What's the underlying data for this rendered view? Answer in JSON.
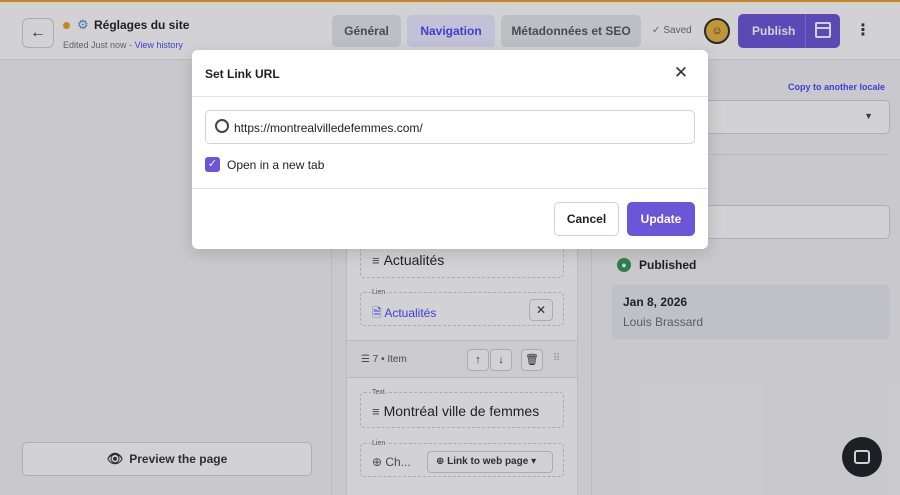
{
  "header": {
    "title": "Réglages du site",
    "edited_prefix": "Edited Just now -",
    "view_history": "View history",
    "tabs": [
      {
        "label": "Général"
      },
      {
        "label": "Navigation"
      },
      {
        "label": "Métadonnées et SEO"
      }
    ],
    "saved_label": "Saved",
    "publish_label": "Publish",
    "accent_color": "#6b55d8"
  },
  "left_panel": {
    "preview_label": "Preview the page"
  },
  "editor": {
    "items": [
      {
        "text": "Actualités",
        "lien_label": "Lien",
        "link_text": "Actualités"
      },
      {
        "item_label": "7 • Item",
        "text_label": "Text",
        "text": "Montréal ville de femmes",
        "lien_label": "Lien",
        "link_text": "Ch...",
        "link_type": "Link to web page"
      }
    ]
  },
  "sidebar": {
    "copy_locale": "Copy to another locale",
    "status": "Published",
    "history": {
      "date": "Jan 8, 2026",
      "user": "Louis Brassard"
    }
  },
  "modal": {
    "title": "Set Link URL",
    "url_value": "https://montrealvilledefemmes.com/",
    "open_new_tab_label": "Open in a new tab",
    "open_new_tab_checked": true,
    "cancel_label": "Cancel",
    "update_label": "Update"
  }
}
